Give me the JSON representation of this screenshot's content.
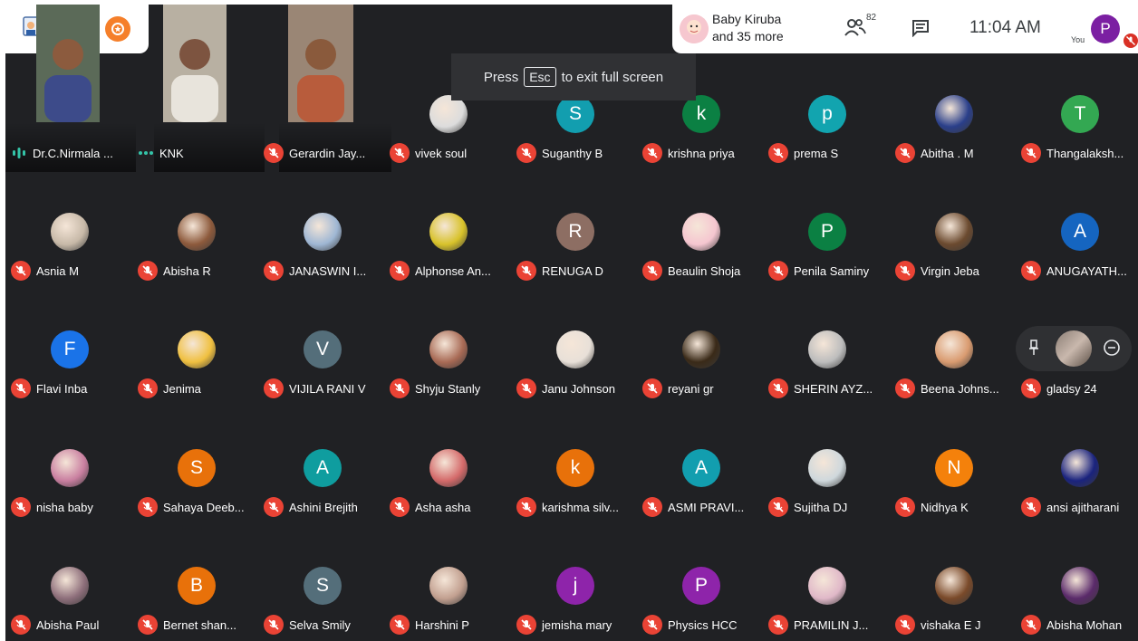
{
  "header": {
    "host_line1": "Baby Kiruba",
    "host_line2": "and 35 more",
    "participant_count": "82",
    "time": "11:04 AM",
    "you_label": "You",
    "self_initial": "P"
  },
  "toast": {
    "press": "Press",
    "key": "Esc",
    "rest": "to exit full screen"
  },
  "colors": {
    "mute_red": "#ea4335",
    "bg": "#202124",
    "accent_orange": "#f57f2a"
  },
  "tiles": [
    {
      "name": "Dr.C.Nirmala ...",
      "kind": "video",
      "mic": "talking"
    },
    {
      "name": "KNK",
      "kind": "video",
      "mic": "dots"
    },
    {
      "name": "Gerardin Jay...",
      "kind": "video",
      "mic": "muted"
    },
    {
      "name": "vivek soul",
      "kind": "photo",
      "bg": "#dcdcdc"
    },
    {
      "name": "Suganthy B",
      "initial": "S",
      "color": "#129eaf"
    },
    {
      "name": "krishna priya",
      "initial": "k",
      "color": "#0b8043"
    },
    {
      "name": "prema S",
      "initial": "p",
      "color": "#12a4af"
    },
    {
      "name": "Abitha . M",
      "kind": "photo",
      "bg": "#2a3f8a"
    },
    {
      "name": "Thangalaksh...",
      "initial": "T",
      "color": "#33a852"
    },
    {
      "name": "Asnia M",
      "kind": "photo",
      "bg": "#c7b9a8"
    },
    {
      "name": "Abisha R",
      "kind": "photo",
      "bg": "#8d5a3c"
    },
    {
      "name": "JANASWIN I...",
      "kind": "photo",
      "bg": "#9fb7d4"
    },
    {
      "name": "Alphonse An...",
      "kind": "photo",
      "bg": "#d8c22a"
    },
    {
      "name": "RENUGA D",
      "initial": "R",
      "color": "#8d6e63"
    },
    {
      "name": "Beaulin Shoja",
      "kind": "photo",
      "bg": "#f5c6d0"
    },
    {
      "name": "Penila Saminy",
      "initial": "P",
      "color": "#0b8043"
    },
    {
      "name": "Virgin Jeba",
      "kind": "photo",
      "bg": "#6b4a2f"
    },
    {
      "name": "ANUGAYATH...",
      "initial": "A",
      "color": "#1565c0"
    },
    {
      "name": "Flavi Inba",
      "initial": "F",
      "color": "#1a73e8"
    },
    {
      "name": "Jenima",
      "kind": "photo",
      "bg": "#f0c040"
    },
    {
      "name": "VIJILA RANI V",
      "initial": "V",
      "color": "#546e7a"
    },
    {
      "name": "Shyju Stanly",
      "kind": "photo",
      "bg": "#a86a55"
    },
    {
      "name": "Janu Johnson",
      "kind": "photo",
      "bg": "#e8e0d8"
    },
    {
      "name": "reyani gr",
      "kind": "photo",
      "bg": "#3a2a18"
    },
    {
      "name": "SHERIN AYZ...",
      "kind": "photo",
      "bg": "#bdbdbd"
    },
    {
      "name": "Beena Johns...",
      "kind": "photo",
      "bg": "#d99b70"
    },
    {
      "name": "gladsy 24",
      "kind": "hover"
    },
    {
      "name": "nisha baby",
      "kind": "photo",
      "bg": "#c97fa0"
    },
    {
      "name": "Sahaya Deeb...",
      "initial": "S",
      "color": "#e8710a"
    },
    {
      "name": "Ashini Brejith",
      "initial": "A",
      "color": "#0f9d9f"
    },
    {
      "name": "Asha asha",
      "kind": "photo",
      "bg": "#d46a6a"
    },
    {
      "name": "karishma silv...",
      "initial": "k",
      "color": "#e8710a"
    },
    {
      "name": "ASMI PRAVI...",
      "initial": "A",
      "color": "#129eaf"
    },
    {
      "name": "Sujitha DJ",
      "kind": "photo",
      "bg": "#cfd8dc"
    },
    {
      "name": "Nidhya K",
      "initial": "N",
      "color": "#f4810b"
    },
    {
      "name": "ansi ajitharani",
      "kind": "photo",
      "bg": "#1a237e"
    },
    {
      "name": "Abisha Paul",
      "kind": "photo",
      "bg": "#8e6f7b"
    },
    {
      "name": "Bernet shan...",
      "initial": "B",
      "color": "#e8710a"
    },
    {
      "name": "Selva Smily",
      "initial": "S",
      "color": "#546e7a"
    },
    {
      "name": "Harshini P",
      "kind": "photo",
      "bg": "#c2a090"
    },
    {
      "name": "jemisha mary",
      "initial": "j",
      "color": "#8e24aa"
    },
    {
      "name": "Physics HCC",
      "initial": "P",
      "color": "#8e24aa"
    },
    {
      "name": "PRAMILIN J...",
      "kind": "photo",
      "bg": "#e0b8c8"
    },
    {
      "name": "vishaka E J",
      "kind": "photo",
      "bg": "#7a4a2a"
    },
    {
      "name": "Abisha Mohan",
      "kind": "photo",
      "bg": "#5a2a6a"
    }
  ]
}
